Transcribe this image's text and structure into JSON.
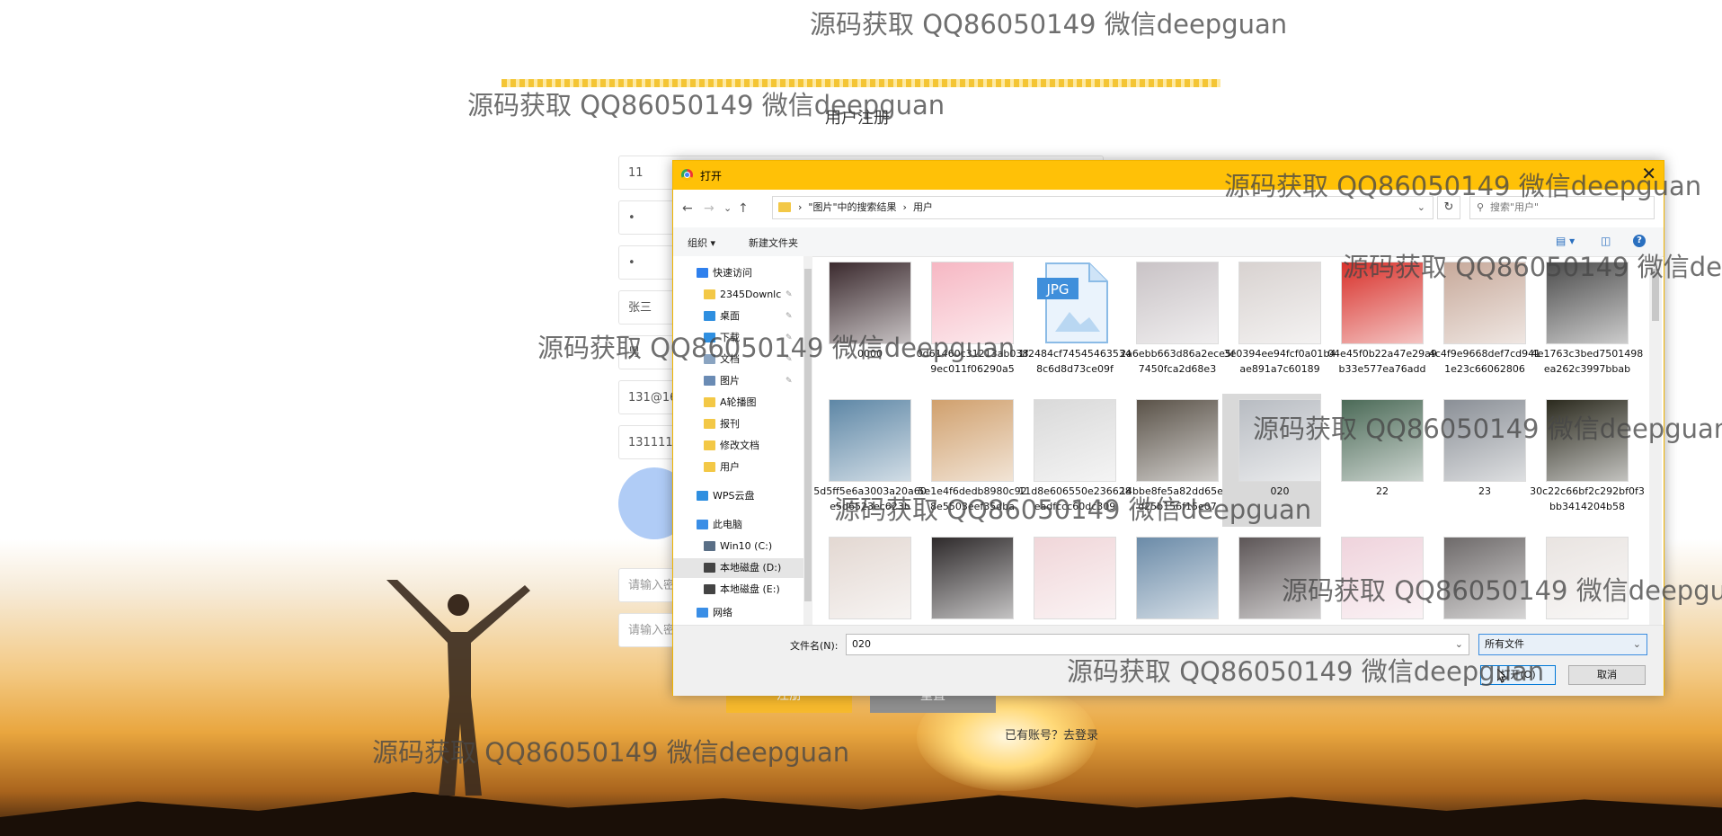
{
  "page": {
    "title": "用户注册",
    "fields": [
      "11",
      "•",
      "•",
      "张三",
      "男",
      "131@16",
      "1311111"
    ],
    "placeholders": [
      "请输入密",
      "请输入密"
    ],
    "register_label": "注册",
    "reset_label": "重置",
    "login_prompt": "已有账号？去登录"
  },
  "dialog": {
    "title": "打开",
    "close_glyph": "✕",
    "nav": {
      "back": "←",
      "forward": "→",
      "recent": "⌄",
      "up": "↑"
    },
    "breadcrumb": [
      "\"图片\"中的搜索结果",
      "用户"
    ],
    "breadcrumb_sep": "›",
    "refresh_glyph": "↻",
    "search_placeholder": "搜索\"用户\"",
    "toolbar": {
      "organize": "组织 ▾",
      "new_folder": "新建文件夹",
      "help": "?"
    },
    "sidebar": [
      {
        "label": "快速访问",
        "icon": "star-icon",
        "color": "#2f80ed",
        "pinned": false
      },
      {
        "label": "2345Downlc",
        "icon": "folder-icon",
        "color": "#f3c846",
        "pinned": true
      },
      {
        "label": "桌面",
        "icon": "desktop-icon",
        "color": "#2f8fe0",
        "pinned": true
      },
      {
        "label": "下载",
        "icon": "download-icon",
        "color": "#2f8fe0",
        "pinned": true
      },
      {
        "label": "文档",
        "icon": "document-icon",
        "color": "#8aa4c1",
        "pinned": true
      },
      {
        "label": "图片",
        "icon": "pictures-icon",
        "color": "#6a8bb4",
        "pinned": true
      },
      {
        "label": "A轮播图",
        "icon": "folder-icon",
        "color": "#f3c846",
        "pinned": false
      },
      {
        "label": "报刊",
        "icon": "folder-icon",
        "color": "#f3c846",
        "pinned": false
      },
      {
        "label": "修改文档",
        "icon": "folder-icon",
        "color": "#f3c846",
        "pinned": false
      },
      {
        "label": "用户",
        "icon": "folder-icon",
        "color": "#f3c846",
        "pinned": false
      },
      {
        "label": "WPS云盘",
        "icon": "cloud-icon",
        "color": "#2f8fe0",
        "pinned": false
      },
      {
        "label": "此电脑",
        "icon": "computer-icon",
        "color": "#3a8ee6",
        "pinned": false
      },
      {
        "label": "Win10 (C:)",
        "icon": "drive-icon",
        "color": "#5a6f86",
        "pinned": false
      },
      {
        "label": "本地磁盘 (D:)",
        "icon": "drive-icon",
        "color": "#444444",
        "pinned": false,
        "selected": true
      },
      {
        "label": "本地磁盘 (E:)",
        "icon": "drive-icon",
        "color": "#444444",
        "pinned": false
      },
      {
        "label": "网络",
        "icon": "network-icon",
        "color": "#3a8ee6",
        "pinned": false
      }
    ],
    "files": [
      {
        "name": "0000",
        "color": "#3b2a2e",
        "kind": "photo"
      },
      {
        "name": "0d61460c31213ab0389ec011f06290a5",
        "color": "#f6b7c3",
        "kind": "photo"
      },
      {
        "name": "1f2484cf745454635348c6d8d73ce09f",
        "color": "#ffffff",
        "kind": "jpg"
      },
      {
        "name": "2a6ebb663d86a2ece5f7450fca2d68e3",
        "color": "#c9c3c6",
        "kind": "photo"
      },
      {
        "name": "3e0394ee94fcf0a01b4ae891a7c60189",
        "color": "#d8d2d0",
        "kind": "photo"
      },
      {
        "name": "04e45f0b22a47e29a9b33e577ea76add",
        "color": "#d8312b",
        "kind": "photo"
      },
      {
        "name": "4c4f9e9668def7cd9411e23c66062806",
        "color": "#c7a99a",
        "kind": "photo"
      },
      {
        "name": "4e1763c3bed7501498ea262c3997bbab",
        "color": "#4c4c4c",
        "kind": "photo"
      },
      {
        "name": "5d5ff5e6a3003a20a60e5d6523ec623b",
        "color": "#5e87a6",
        "kind": "photo"
      },
      {
        "name": "5e1e4f6dedb8980c928e5503eef35dba",
        "color": "#d0a06d",
        "kind": "photo"
      },
      {
        "name": "11d8e606550e236628eadfccc60dc309",
        "color": "#d9d9d9",
        "kind": "photo"
      },
      {
        "name": "14bbe8fe5a82dd65ec4d25b156f15e07",
        "color": "#5a5248",
        "kind": "photo"
      },
      {
        "name": "020",
        "color": "#b8bcc2",
        "kind": "photo",
        "selected": true
      },
      {
        "name": "22",
        "color": "#4b6a57",
        "kind": "photo"
      },
      {
        "name": "23",
        "color": "#8a8f96",
        "kind": "photo"
      },
      {
        "name": "30c22c66bf2c292bf0f3bb3414204b58",
        "color": "#2b2a1e",
        "kind": "photo"
      },
      {
        "name": "",
        "color": "#e3d8d2",
        "kind": "photo"
      },
      {
        "name": "",
        "color": "#2e2a2b",
        "kind": "photo"
      },
      {
        "name": "",
        "color": "#f0d6d9",
        "kind": "photo"
      },
      {
        "name": "",
        "color": "#6b8ba8",
        "kind": "photo"
      },
      {
        "name": "",
        "color": "#5d5657",
        "kind": "photo"
      },
      {
        "name": "",
        "color": "#efd3dc",
        "kind": "photo"
      },
      {
        "name": "",
        "color": "#6e6a6a",
        "kind": "photo"
      },
      {
        "name": "",
        "color": "#e9e4e1",
        "kind": "photo"
      }
    ],
    "filename_label": "文件名(N):",
    "filename_value": "020",
    "filetype_value": "所有文件",
    "open_label": "打开(O)",
    "cancel_label": "取消",
    "dropdown_glyph": "⌄"
  },
  "watermark_text": "源码获取 QQ86050149 微信deepguan"
}
